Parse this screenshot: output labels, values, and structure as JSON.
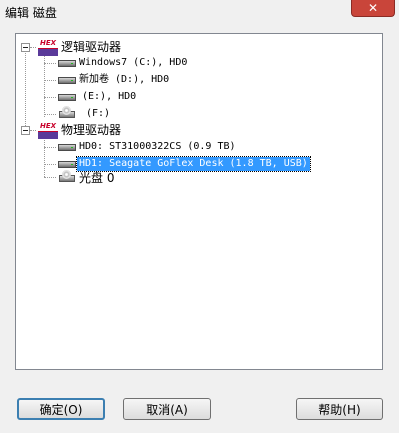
{
  "window": {
    "title": "编辑 磁盘",
    "close_glyph": "✕"
  },
  "tree": {
    "logical_group": {
      "label": "逻辑驱动器",
      "icon": "hex-drive-group-icon",
      "items": [
        {
          "label": "Windows7 (C:), HD0",
          "icon": "hard-drive-icon"
        },
        {
          "label": "新加卷 (D:), HD0",
          "icon": "hard-drive-icon"
        },
        {
          "label": "(E:), HD0",
          "icon": "hard-drive-icon"
        },
        {
          "label": "(F:)",
          "icon": "cd-drive-icon"
        }
      ]
    },
    "physical_group": {
      "label": "物理驱动器",
      "icon": "hex-drive-group-icon",
      "items": [
        {
          "label": "HD0: ST31000322CS (0.9 TB)",
          "icon": "hard-drive-icon"
        },
        {
          "label": "HD1: Seagate GoFlex Desk (1.8 TB, USB)",
          "icon": "hard-drive-icon",
          "selected": true
        },
        {
          "label": "光盘 0",
          "icon": "cd-drive-icon"
        }
      ]
    }
  },
  "buttons": {
    "ok": "确定(O)",
    "cancel": "取消(A)",
    "help": "帮助(H)"
  },
  "colors": {
    "selection": "#3399ff",
    "close_button": "#c9453a",
    "hex_red": "#c8002a",
    "hex_purple": "#5a3a9a"
  }
}
